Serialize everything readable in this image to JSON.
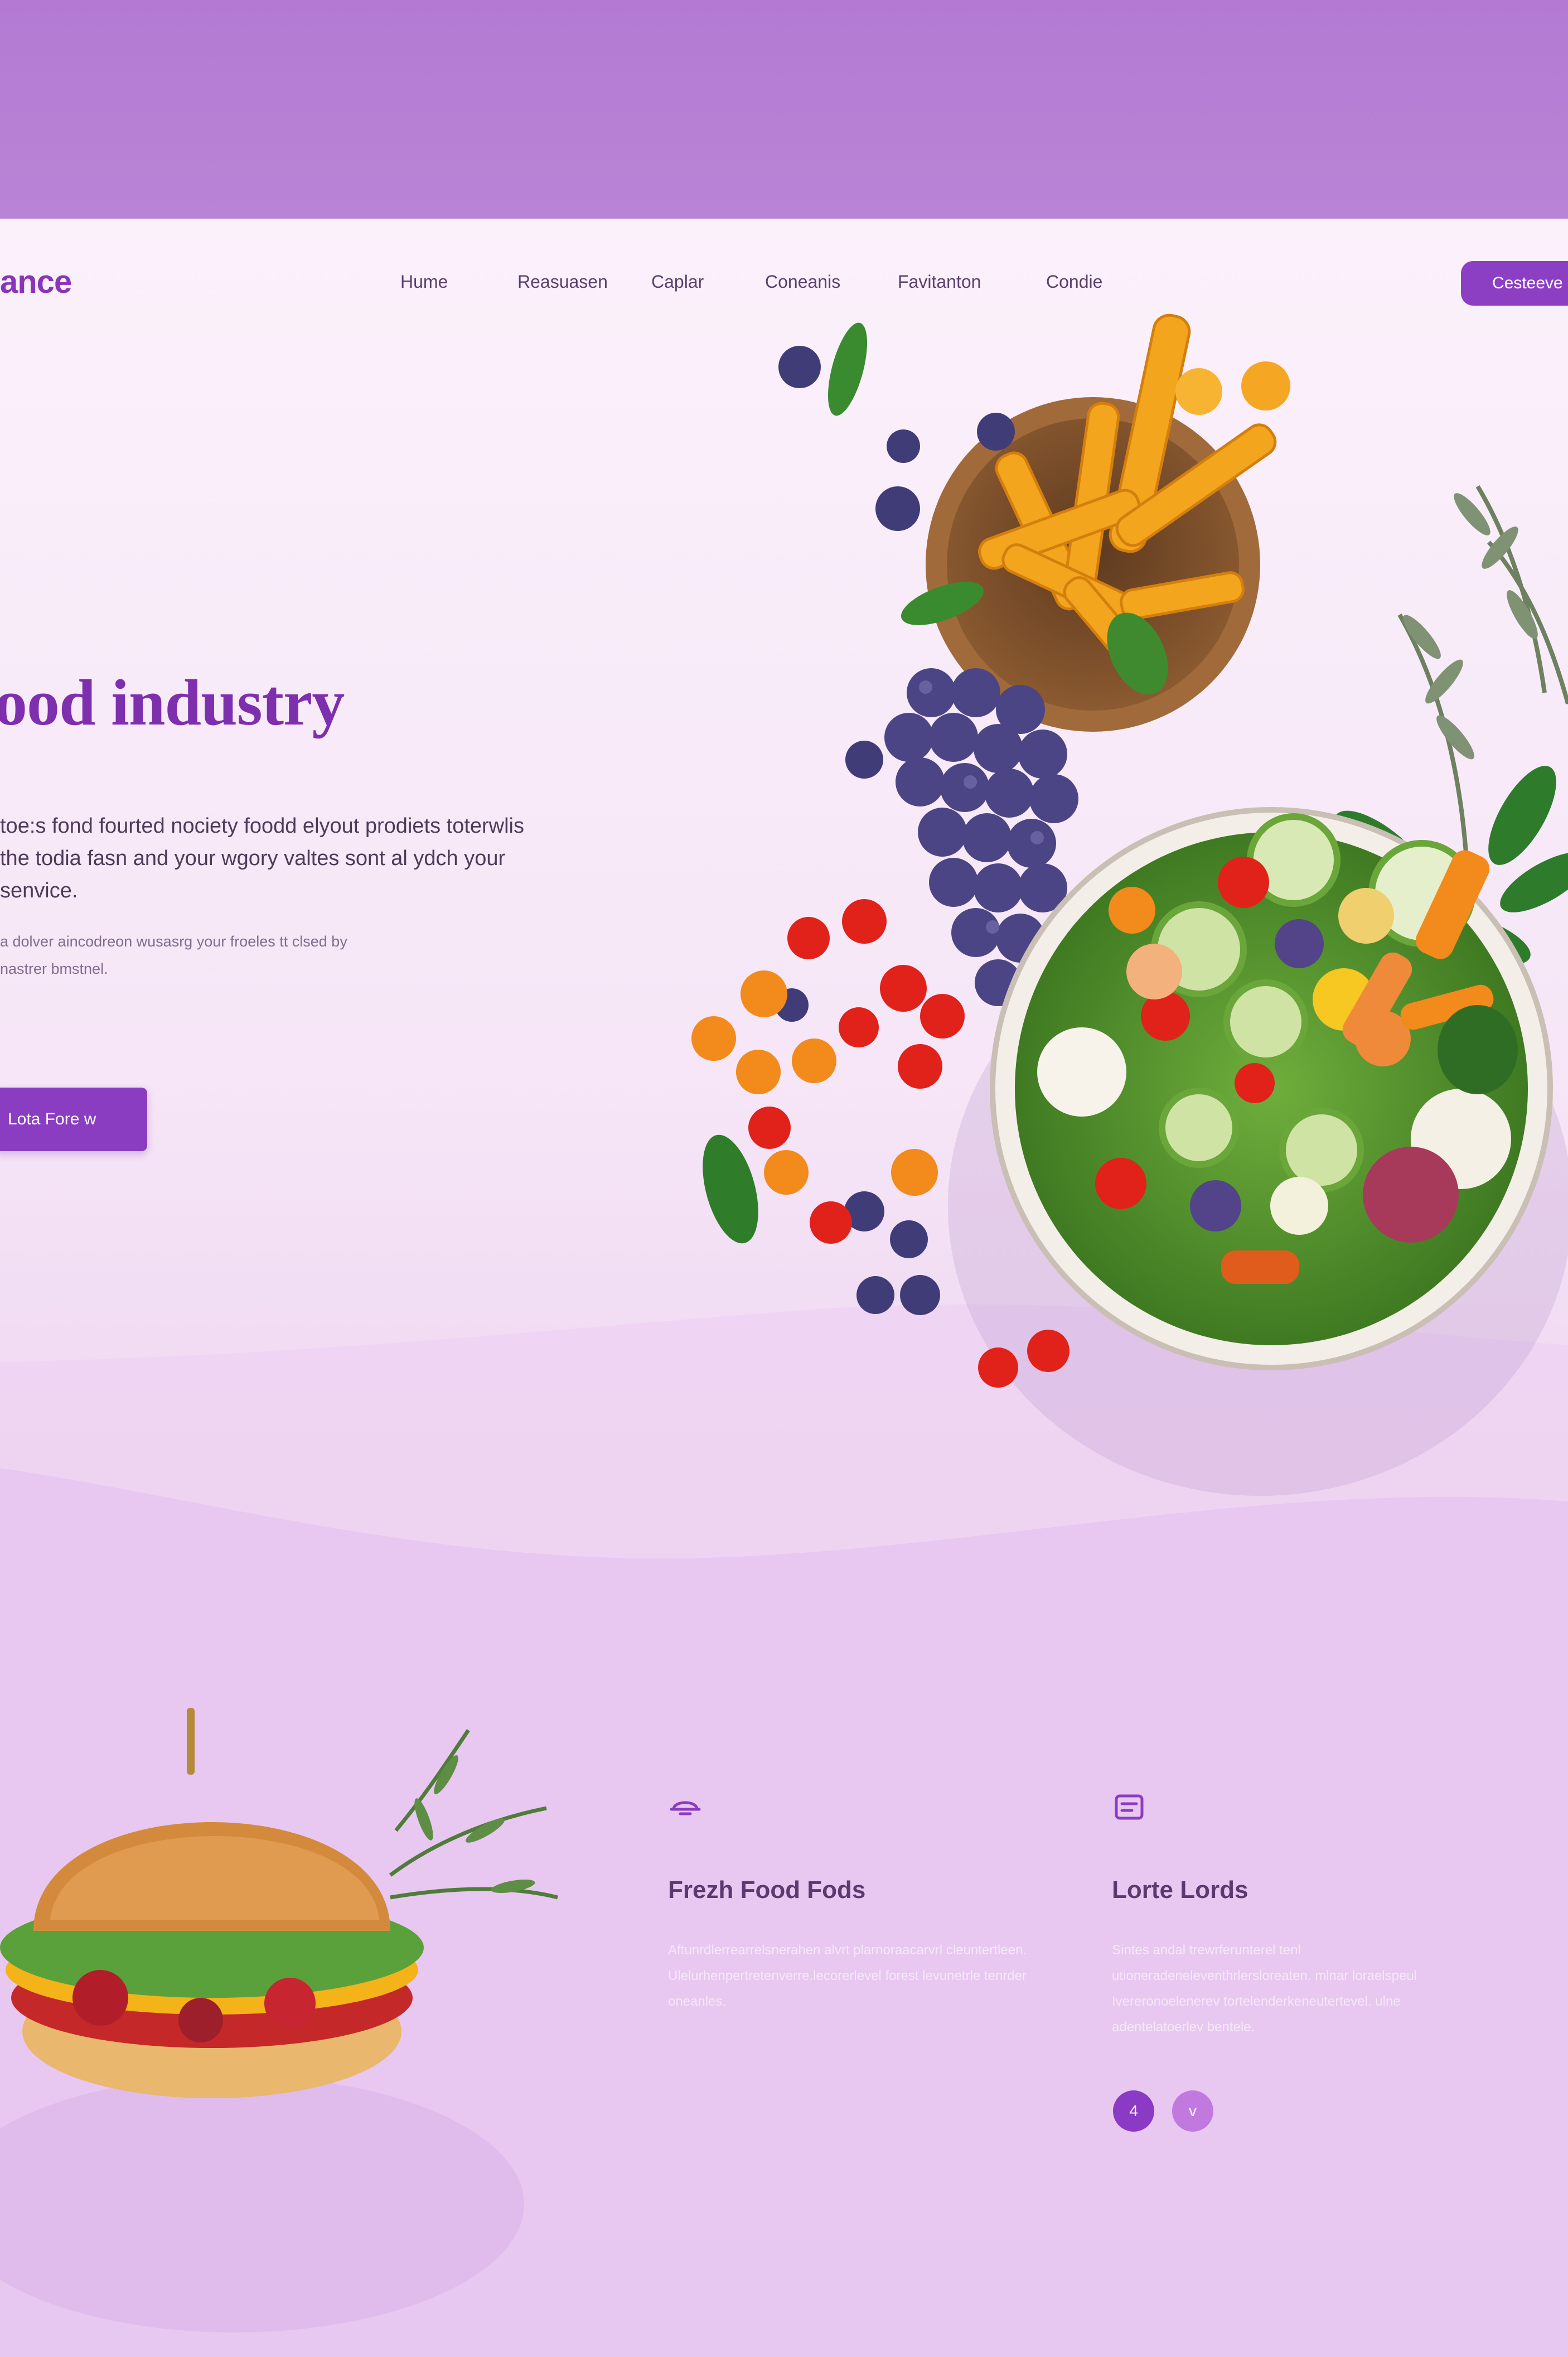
{
  "brand": {
    "name": "ance"
  },
  "nav": {
    "items": [
      "Hume",
      "Reasuasen",
      "Caplar",
      "Coneanis",
      "Favitanton",
      "Condie"
    ],
    "cta_label": "Cesteeve"
  },
  "hero": {
    "title": "ood industry",
    "description": "toe:s fond fourted nociety foodd elyout prodiets toterwlis the todia fasn and your wgory valtes sont al ydch your senvice.",
    "small_text": "a dolver aincodreon wusasrg your froeles tt clsed by nastrer bmstnel.",
    "button_label": "Lota Fore w"
  },
  "features": [
    {
      "icon": "dish-icon",
      "title": "Frezh Food Fods",
      "text": "Aftunrdlerrearrelsnerahen alvrt plarnoraacarvrl cleuntertleen. Ulelurhenpertretenverre.lecorerlevel forest levunetrle tenrder oneanles."
    },
    {
      "icon": "menu-icon",
      "title": "Lorte Lords",
      "text": "Sintes andal trewrferunterel tenl utioneradeneleventhrlersloreaten. mlnar loraelspeul Ivereronoelenerev tortelenderkeneutertevel. ulne adentelatoerlev bentele."
    }
  ],
  "pager": {
    "dot_1": "4",
    "dot_2": "v"
  },
  "colors": {
    "brand_purple": "#8a3dc1",
    "title_purple": "#7e2fad",
    "top_band": "#b47ad3"
  }
}
